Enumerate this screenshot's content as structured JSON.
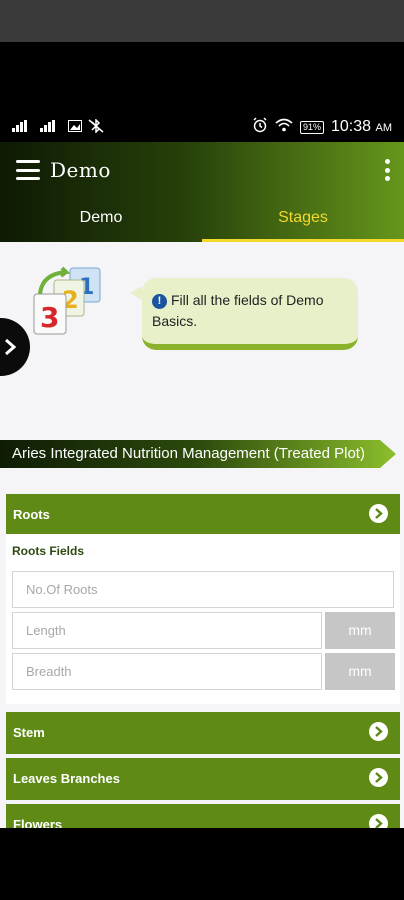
{
  "status": {
    "time": "10:38",
    "ampm": "AM",
    "battery": "91%"
  },
  "appbar": {
    "title": "Demo",
    "tabs": [
      "Demo",
      "Stages"
    ],
    "active_tab": "Stages"
  },
  "intro": {
    "message": "Fill all the fields of Demo Basics."
  },
  "banner": {
    "title": "Aries Integrated Nutrition Management (Treated Plot)"
  },
  "sections": {
    "roots": "Roots",
    "stem": "Stem",
    "leaves": "Leaves Branches",
    "flowers": "Flowers"
  },
  "roots_fields": {
    "title": "Roots Fields",
    "no_of_roots_placeholder": "No.Of Roots",
    "length_placeholder": "Length",
    "breadth_placeholder": "Breadth",
    "length_unit": "mm",
    "breadth_unit": "mm"
  },
  "colors": {
    "accent_green": "#5f8a16",
    "tab_active": "#f3d92a",
    "info_blue": "#1b55a0"
  }
}
